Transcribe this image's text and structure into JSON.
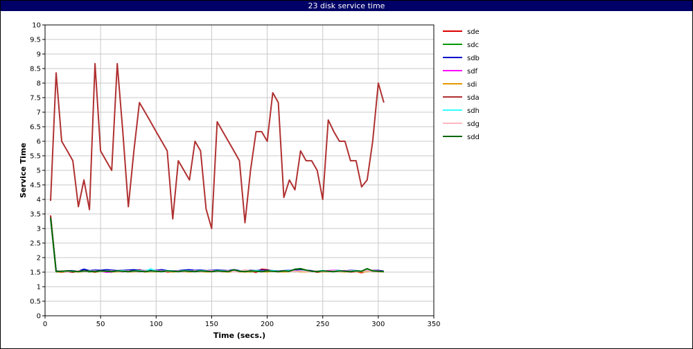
{
  "chart_data": {
    "type": "line",
    "title": "23 disk service time",
    "xlabel": "Time (secs.)",
    "ylabel": "Service Time",
    "xlim": [
      0,
      350
    ],
    "ylim": [
      0,
      10
    ],
    "x_ticks": [
      0,
      50,
      100,
      150,
      200,
      250,
      300,
      350
    ],
    "y_ticks": [
      0,
      0.5,
      1,
      1.5,
      2,
      2.5,
      3,
      3.5,
      4,
      4.5,
      5,
      5.5,
      6,
      6.5,
      7,
      7.5,
      8,
      8.5,
      9,
      9.5,
      10
    ],
    "grid": true,
    "legend_position": "right",
    "x": [
      5,
      10,
      15,
      20,
      25,
      30,
      35,
      40,
      45,
      50,
      55,
      60,
      65,
      70,
      75,
      80,
      85,
      90,
      95,
      100,
      105,
      110,
      115,
      120,
      125,
      130,
      135,
      140,
      145,
      150,
      155,
      160,
      165,
      170,
      175,
      180,
      185,
      190,
      195,
      200,
      205,
      210,
      215,
      220,
      225,
      230,
      235,
      240,
      245,
      250,
      255,
      260,
      265,
      270,
      275,
      280,
      285,
      290,
      295,
      300,
      305
    ],
    "series": [
      {
        "name": "sde",
        "color": "#dd0000",
        "values": [
          3.45,
          1.52,
          1.5,
          1.52,
          1.5,
          1.54,
          1.52,
          1.53,
          1.5,
          1.53,
          1.52,
          1.51,
          1.53,
          1.52,
          1.54,
          1.53,
          1.58,
          1.51,
          1.55,
          1.53,
          1.58,
          1.5,
          1.52,
          1.53,
          1.55,
          1.52,
          1.54,
          1.56,
          1.55,
          1.52,
          1.57,
          1.53,
          1.52,
          1.55,
          1.53,
          1.52,
          1.54,
          1.49,
          1.6,
          1.58,
          1.53,
          1.52,
          1.54,
          1.53,
          1.56,
          1.55,
          1.52,
          1.54,
          1.5,
          1.52,
          1.53,
          1.54,
          1.52,
          1.53,
          1.51,
          1.52,
          1.48,
          1.54,
          1.56,
          1.55,
          1.53
        ]
      },
      {
        "name": "sdc",
        "color": "#009900",
        "values": [
          3.4,
          1.54,
          1.52,
          1.53,
          1.52,
          1.53,
          1.54,
          1.51,
          1.55,
          1.52,
          1.54,
          1.52,
          1.54,
          1.53,
          1.52,
          1.55,
          1.52,
          1.54,
          1.53,
          1.52,
          1.55,
          1.53,
          1.51,
          1.54,
          1.52,
          1.55,
          1.53,
          1.52,
          1.54,
          1.53,
          1.52,
          1.55,
          1.52,
          1.53,
          1.54,
          1.53,
          1.51,
          1.54,
          1.55,
          1.52,
          1.54,
          1.52,
          1.53,
          1.54,
          1.52,
          1.58,
          1.55,
          1.53,
          1.52,
          1.54,
          1.53,
          1.52,
          1.55,
          1.52,
          1.53,
          1.54,
          1.52,
          1.54,
          1.52,
          1.53,
          1.51
        ]
      },
      {
        "name": "sdb",
        "color": "#0000cc",
        "values": [
          3.35,
          1.55,
          1.53,
          1.54,
          1.55,
          1.53,
          1.6,
          1.55,
          1.57,
          1.56,
          1.58,
          1.57,
          1.55,
          1.56,
          1.57,
          1.58,
          1.56,
          1.55,
          1.57,
          1.56,
          1.58,
          1.55,
          1.54,
          1.55,
          1.57,
          1.58,
          1.56,
          1.57,
          1.55,
          1.56,
          1.57,
          1.56,
          1.55,
          1.58,
          1.55,
          1.54,
          1.56,
          1.55,
          1.57,
          1.56,
          1.55,
          1.54,
          1.55,
          1.56,
          1.55,
          1.57,
          1.56,
          1.55,
          1.52,
          1.51,
          1.53,
          1.56,
          1.55,
          1.54,
          1.56,
          1.55,
          1.53,
          1.54,
          1.55,
          1.56,
          1.53
        ]
      },
      {
        "name": "sdf",
        "color": "#ff00ff",
        "values": [
          3.38,
          1.53,
          1.52,
          1.51,
          1.53,
          1.52,
          1.53,
          1.54,
          1.52,
          1.53,
          1.5,
          1.51,
          1.53,
          1.52,
          1.54,
          1.53,
          1.52,
          1.54,
          1.53,
          1.55,
          1.53,
          1.52,
          1.54,
          1.53,
          1.52,
          1.54,
          1.53,
          1.52,
          1.54,
          1.55,
          1.53,
          1.52,
          1.54,
          1.53,
          1.52,
          1.53,
          1.55,
          1.54,
          1.52,
          1.53,
          1.54,
          1.52,
          1.53,
          1.55,
          1.54,
          1.52,
          1.53,
          1.54,
          1.52,
          1.53,
          1.55,
          1.56,
          1.54,
          1.55,
          1.53,
          1.54,
          1.52,
          1.53,
          1.55,
          1.54,
          1.52
        ]
      },
      {
        "name": "sdi",
        "color": "#e69900",
        "values": [
          3.36,
          1.52,
          1.51,
          1.52,
          1.53,
          1.51,
          1.52,
          1.53,
          1.51,
          1.52,
          1.53,
          1.52,
          1.51,
          1.53,
          1.52,
          1.51,
          1.53,
          1.52,
          1.51,
          1.52,
          1.53,
          1.52,
          1.51,
          1.53,
          1.52,
          1.51,
          1.53,
          1.52,
          1.51,
          1.52,
          1.53,
          1.52,
          1.51,
          1.53,
          1.52,
          1.51,
          1.52,
          1.53,
          1.52,
          1.51,
          1.53,
          1.52,
          1.51,
          1.52,
          1.53,
          1.52,
          1.51,
          1.53,
          1.52,
          1.51,
          1.52,
          1.53,
          1.52,
          1.51,
          1.53,
          1.52,
          1.51,
          1.52,
          1.53,
          1.52,
          1.51
        ]
      },
      {
        "name": "sda",
        "color": "#b03030",
        "values": [
          3.95,
          8.35,
          6.0,
          5.67,
          5.33,
          3.75,
          4.67,
          3.65,
          8.67,
          5.67,
          5.33,
          5.0,
          8.67,
          6.33,
          3.75,
          5.67,
          7.33,
          7.0,
          6.67,
          6.33,
          6.0,
          5.67,
          3.33,
          5.33,
          5.0,
          4.67,
          6.0,
          5.67,
          3.67,
          3.0,
          6.67,
          6.33,
          6.0,
          5.67,
          5.33,
          3.2,
          5.0,
          6.33,
          6.33,
          6.0,
          7.67,
          7.33,
          4.07,
          4.67,
          4.33,
          5.67,
          5.33,
          5.33,
          5.0,
          4.0,
          6.73,
          6.33,
          6.0,
          6.0,
          5.33,
          5.33,
          4.43,
          4.67,
          6.0,
          8.0,
          7.33
        ]
      },
      {
        "name": "sdh",
        "color": "#33ffff",
        "values": [
          3.3,
          1.54,
          1.53,
          1.52,
          1.54,
          1.53,
          1.52,
          1.54,
          1.53,
          1.52,
          1.54,
          1.53,
          1.54,
          1.55,
          1.53,
          1.54,
          1.55,
          1.53,
          1.61,
          1.54,
          1.53,
          1.55,
          1.54,
          1.53,
          1.55,
          1.54,
          1.53,
          1.55,
          1.54,
          1.53,
          1.55,
          1.54,
          1.53,
          1.55,
          1.54,
          1.53,
          1.54,
          1.55,
          1.53,
          1.54,
          1.55,
          1.53,
          1.54,
          1.55,
          1.53,
          1.54,
          1.55,
          1.53,
          1.54,
          1.55,
          1.53,
          1.54,
          1.55,
          1.53,
          1.54,
          1.55,
          1.53,
          1.54,
          1.55,
          1.53,
          1.52
        ]
      },
      {
        "name": "sdg",
        "color": "#ffb6c1",
        "values": [
          3.32,
          1.53,
          1.54,
          1.52,
          1.53,
          1.54,
          1.52,
          1.53,
          1.54,
          1.52,
          1.53,
          1.54,
          1.52,
          1.53,
          1.54,
          1.52,
          1.53,
          1.54,
          1.52,
          1.53,
          1.54,
          1.52,
          1.53,
          1.54,
          1.52,
          1.53,
          1.54,
          1.52,
          1.53,
          1.54,
          1.52,
          1.53,
          1.54,
          1.52,
          1.53,
          1.58,
          1.54,
          1.52,
          1.53,
          1.54,
          1.52,
          1.53,
          1.54,
          1.52,
          1.53,
          1.54,
          1.52,
          1.53,
          1.54,
          1.52,
          1.53,
          1.54,
          1.52,
          1.53,
          1.54,
          1.52,
          1.53,
          1.54,
          1.52,
          1.53,
          1.52
        ]
      },
      {
        "name": "sdd",
        "color": "#006600",
        "values": [
          3.37,
          1.52,
          1.53,
          1.54,
          1.53,
          1.52,
          1.54,
          1.53,
          1.52,
          1.54,
          1.53,
          1.52,
          1.54,
          1.53,
          1.52,
          1.54,
          1.53,
          1.52,
          1.54,
          1.53,
          1.52,
          1.54,
          1.53,
          1.52,
          1.54,
          1.53,
          1.52,
          1.54,
          1.53,
          1.52,
          1.54,
          1.53,
          1.52,
          1.58,
          1.53,
          1.52,
          1.54,
          1.53,
          1.52,
          1.54,
          1.53,
          1.52,
          1.54,
          1.53,
          1.6,
          1.62,
          1.57,
          1.53,
          1.52,
          1.54,
          1.53,
          1.52,
          1.54,
          1.53,
          1.52,
          1.54,
          1.53,
          1.62,
          1.54,
          1.53,
          1.52
        ]
      }
    ]
  }
}
